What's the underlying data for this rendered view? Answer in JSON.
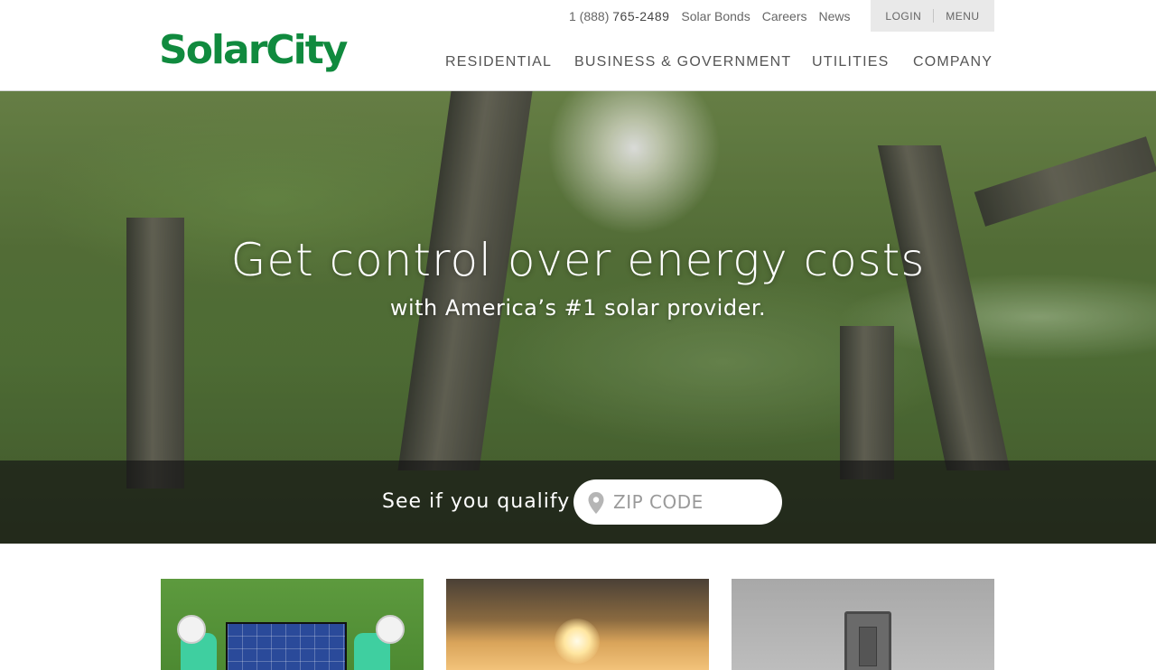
{
  "header": {
    "logo_text": "SolarCity",
    "phone_prefix": "1 (888)",
    "phone_number": "765-2489",
    "util_links": [
      "Solar Bonds",
      "Careers",
      "News"
    ],
    "login_label": "LOGIN",
    "menu_label": "MENU",
    "nav_items": [
      "RESIDENTIAL",
      "BUSINESS & GOVERNMENT",
      "UTILITIES",
      "COMPANY"
    ]
  },
  "hero": {
    "title": "Get control over energy costs",
    "subtitle": "with America’s #1 solar provider.",
    "qualify_label": "See if you qualify",
    "zip_placeholder": "ZIP CODE",
    "zip_value": ""
  },
  "colors": {
    "brand_green": "#108a3e",
    "account_box_bg": "#e9e9e9",
    "qualify_bar_bg": "rgba(20,20,20,0.68)"
  },
  "icons": {
    "zip_icon": "map-pin-icon"
  }
}
